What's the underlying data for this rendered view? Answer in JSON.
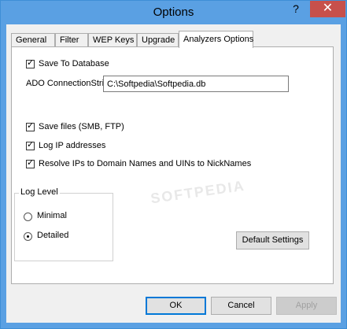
{
  "window": {
    "title": "Options",
    "help_glyph": "?",
    "close_glyph": "✕"
  },
  "tabs": [
    {
      "label": "General"
    },
    {
      "label": "Filter"
    },
    {
      "label": "WEP Keys"
    },
    {
      "label": "Upgrade"
    },
    {
      "label": "Analyzers Options",
      "active": true
    }
  ],
  "panel": {
    "save_to_database": {
      "label": "Save To Database",
      "checked": true
    },
    "ado_connection": {
      "label": "ADO ConnectionString:",
      "value": "C:\\Softpedia\\Softpedia.db"
    },
    "save_files": {
      "label": "Save files (SMB, FTP)",
      "checked": true
    },
    "log_ip": {
      "label": "Log IP addresses",
      "checked": true
    },
    "resolve_ips": {
      "label": "Resolve IPs to Domain Names and UINs to NickNames",
      "checked": true
    },
    "log_level": {
      "title": "Log Level",
      "options": [
        {
          "label": "Minimal",
          "selected": false
        },
        {
          "label": "Detailed",
          "selected": true
        }
      ]
    },
    "default_settings_label": "Default Settings",
    "watermark": "SOFTPEDIA"
  },
  "footer": {
    "ok_label": "OK",
    "cancel_label": "Cancel",
    "apply_label": "Apply"
  }
}
